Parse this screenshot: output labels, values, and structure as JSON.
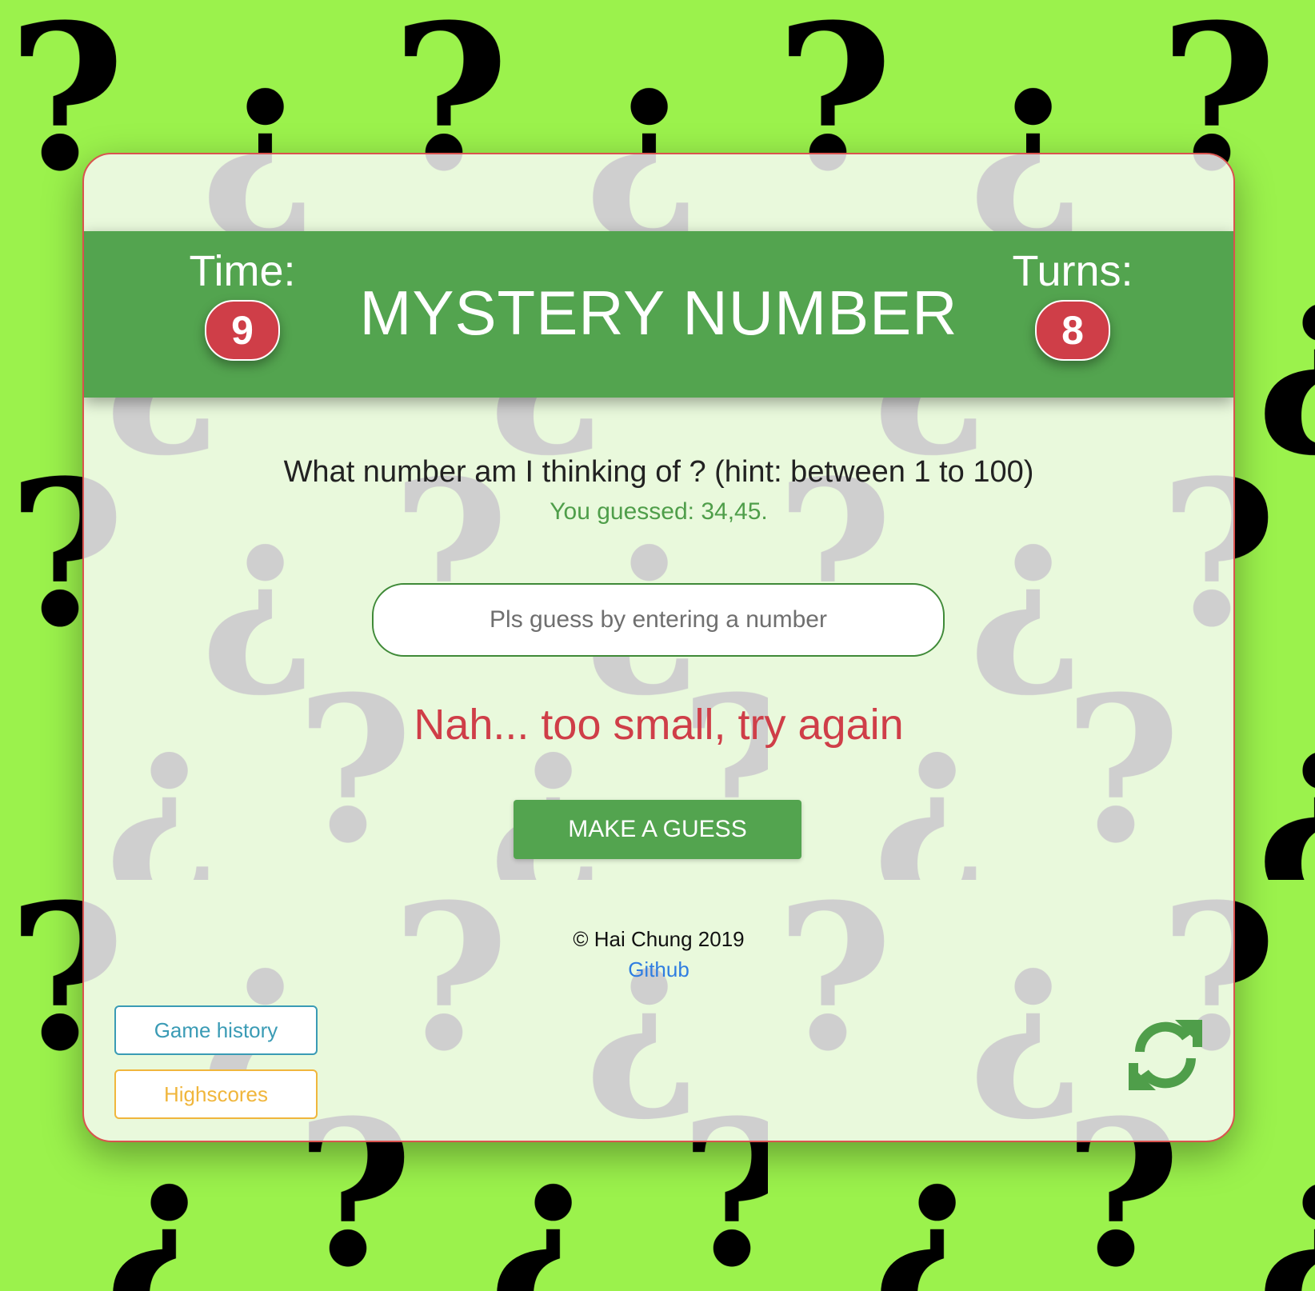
{
  "header": {
    "title": "MYSTERY NUMBER",
    "time_label": "Time:",
    "time_value": "9",
    "turns_label": "Turns:",
    "turns_value": "8"
  },
  "game": {
    "question": "What number am I thinking of ? (hint: between 1 to 100)",
    "guessed_text": "You guessed: 34,45.",
    "input_placeholder": "Pls guess by entering a number",
    "input_value": "",
    "feedback": "Nah... too small, try again",
    "guess_button_label": "MAKE A GUESS"
  },
  "footer": {
    "copyright": "© Hai Chung 2019",
    "github_label": "Github"
  },
  "side_buttons": {
    "history_label": "Game history",
    "highscores_label": "Highscores"
  },
  "icons": {
    "refresh": "refresh-icon"
  },
  "colors": {
    "page_background": "#9bf24c",
    "card_background": "#e9f9dc",
    "header_green": "#53a44f",
    "badge_red": "#cf3e48",
    "feedback_red": "#cf3e48",
    "guessed_green": "#4f9e4a",
    "link_blue": "#2f7de1",
    "history_teal": "#3a9bb5",
    "highscores_amber": "#f0b63c"
  }
}
